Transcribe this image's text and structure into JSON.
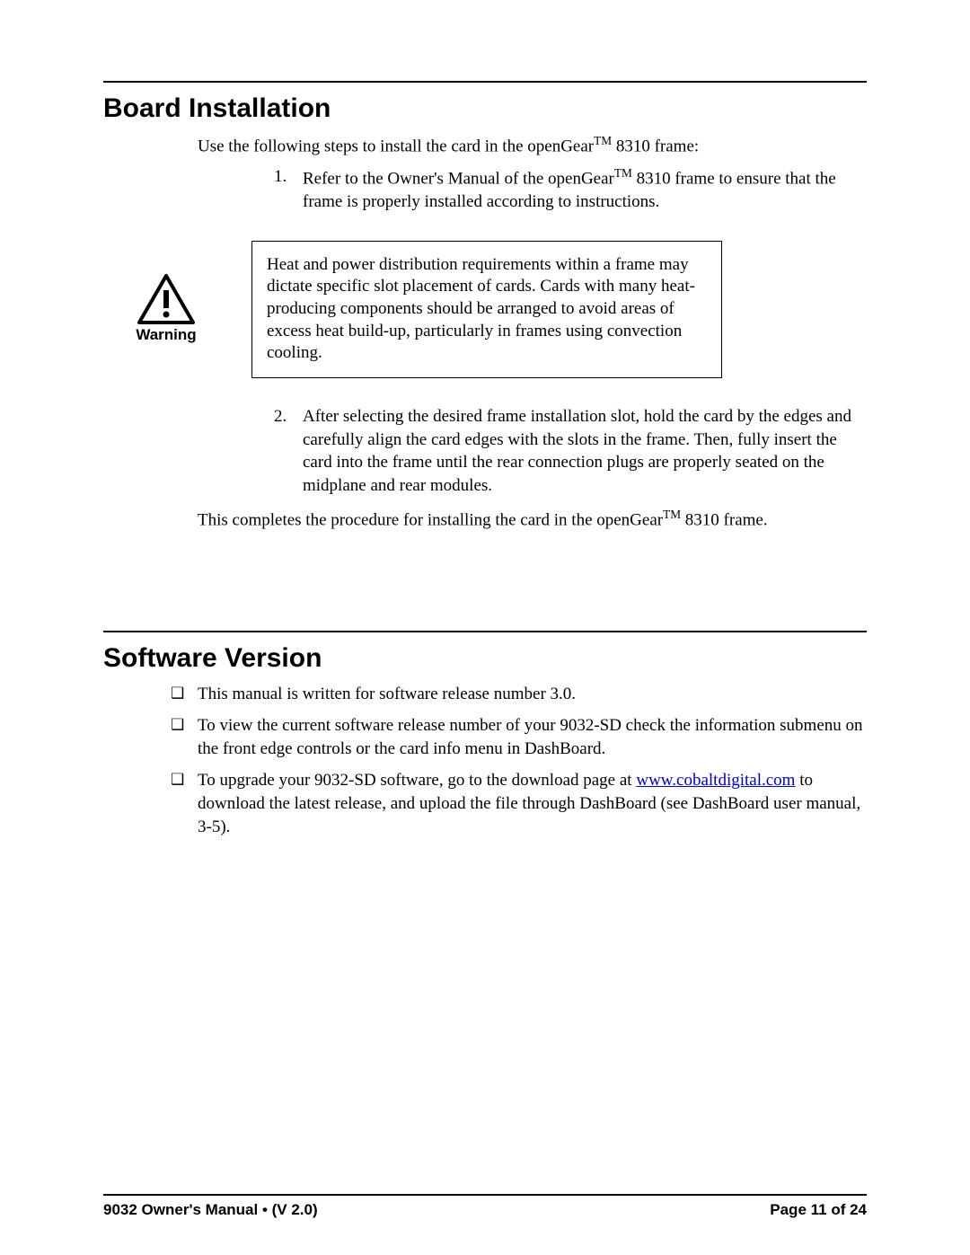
{
  "section1": {
    "heading": "Board Installation",
    "intro_pre": "Use the following steps to install the card in the openGear",
    "intro_sup": "TM",
    "intro_post": " 8310 frame:",
    "step1": {
      "num": "1.",
      "pre": "Refer to the Owner's Manual of the openGear",
      "sup": "TM",
      "post": " 8310 frame to ensure that the frame is properly installed according to instructions."
    },
    "warning_label": "Warning",
    "warning_text": "Heat and power distribution requirements within a frame may dictate specific slot placement of cards.  Cards with many heat-producing components should be arranged to avoid areas of excess heat build-up, particularly in frames using convection cooling.",
    "step2": {
      "num": "2.",
      "text": "After selecting the desired frame installation slot, hold the card by the edges and carefully align the card edges with the slots in the frame.  Then, fully insert the card into the frame until the rear connection plugs are properly seated on the midplane and rear modules."
    },
    "conclusion_pre": "This completes the procedure for installing the card in the openGear",
    "conclusion_sup": "TM",
    "conclusion_post": " 8310 frame."
  },
  "section2": {
    "heading": "Software Version",
    "items": [
      {
        "text": "This manual is written for software release number  3.0."
      },
      {
        "text": "To view the current software release number of your 9032-SD check the information submenu on the front edge controls or the card info menu in DashBoard."
      },
      {
        "pre": "To upgrade your 9032-SD software, go to the download page at ",
        "link": "www.cobaltdigital.com",
        "post": " to download the latest release, and upload the file through DashBoard (see DashBoard user manual, 3-5)."
      }
    ]
  },
  "footer": {
    "left": "9032 Owner's Manual  •  (V 2.0)",
    "right": "Page 11 of 24"
  }
}
